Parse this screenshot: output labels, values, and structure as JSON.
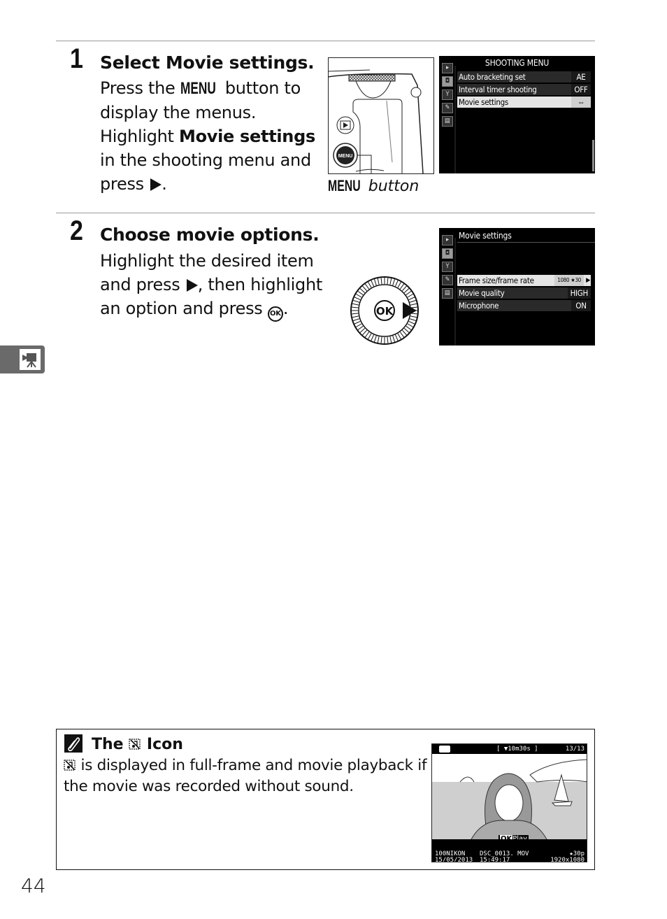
{
  "steps": [
    {
      "number": "1",
      "title": "Select Movie settings.",
      "body": {
        "p1": "Press the ",
        "menu_keyword": "MENU",
        "p2": " button to display the menus. Highlight ",
        "bold": "Movie settings",
        "p3": " in the shooting menu and press ",
        "p4": "."
      },
      "illustration_caption": {
        "keyword": "MENU",
        "text": " button"
      },
      "camera_buttons": {
        "playback": "▶",
        "menu": "MENU"
      },
      "screen": {
        "title": "SHOOTING MENU",
        "tabs": [
          "playback-tab",
          "shooting-tab",
          "setup-tab",
          "retouch-tab",
          "recent-settings-tab"
        ],
        "active_tab": 1,
        "rows": [
          {
            "label": "Auto bracketing set",
            "value": "AE"
          },
          {
            "label": "Interval timer shooting",
            "value": "OFF"
          },
          {
            "label": "Movie settings",
            "value": "--",
            "selected": true
          }
        ]
      }
    },
    {
      "number": "2",
      "title": "Choose movie options.",
      "body": {
        "p1": "Highlight the desired item and press ",
        "p2": ", then highlight an option and press ",
        "ok_glyph": "OK",
        "p3": "."
      },
      "multi_selector": {
        "center": "OK"
      },
      "screen": {
        "title": "Movie settings",
        "active_tab": 1,
        "rows": [
          {
            "label": "Frame size/frame rate",
            "value": "1080 ★30",
            "selected": true
          },
          {
            "label": "Movie quality",
            "value": "HIGH"
          },
          {
            "label": "Microphone",
            "value": "ON"
          }
        ]
      }
    }
  ],
  "side_tab": {
    "icon": "movie-camera-icon"
  },
  "note": {
    "icon": "paperclip-note-icon",
    "title_pre": "The ",
    "title_post": " Icon",
    "body_post": " is displayed in full-frame and movie playback if the movie was recorded without sound.",
    "playback_screen": {
      "duration": "[ ▼10m30s ]",
      "frame_count": "13/13",
      "ok_label": "OK",
      "play_label": "Play",
      "folder": "100NIKON",
      "filename": "DSC_0013. MOV",
      "date": "15/05/2013",
      "time": "15:49:17",
      "quality": "★30p",
      "size": "1920x1080"
    }
  },
  "page_number": "44"
}
